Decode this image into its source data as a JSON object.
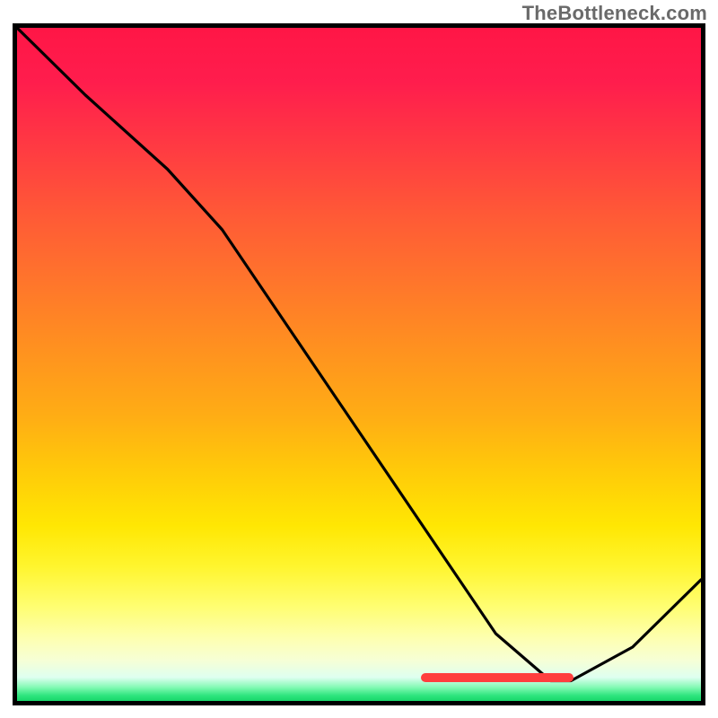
{
  "watermark": "TheBottleneck.com",
  "colors": {
    "gradient_top": "#ff1646",
    "gradient_bottom": "#18d76a",
    "curve": "#000000",
    "frame": "#000000",
    "marker": "#ff3e3e",
    "watermark_text": "#6a6a6a"
  },
  "chart_data": {
    "type": "line",
    "title": "",
    "xlabel": "",
    "ylabel": "",
    "xlim": [
      0,
      100
    ],
    "ylim": [
      0,
      100
    ],
    "x": [
      0,
      10,
      22,
      30,
      40,
      50,
      60,
      70,
      78,
      81,
      90,
      100
    ],
    "y": [
      100,
      90,
      79,
      70,
      55,
      40,
      25,
      10,
      3,
      3,
      8,
      18
    ],
    "marker_range_x": [
      59,
      81
    ],
    "marker_y": 3.3
  }
}
